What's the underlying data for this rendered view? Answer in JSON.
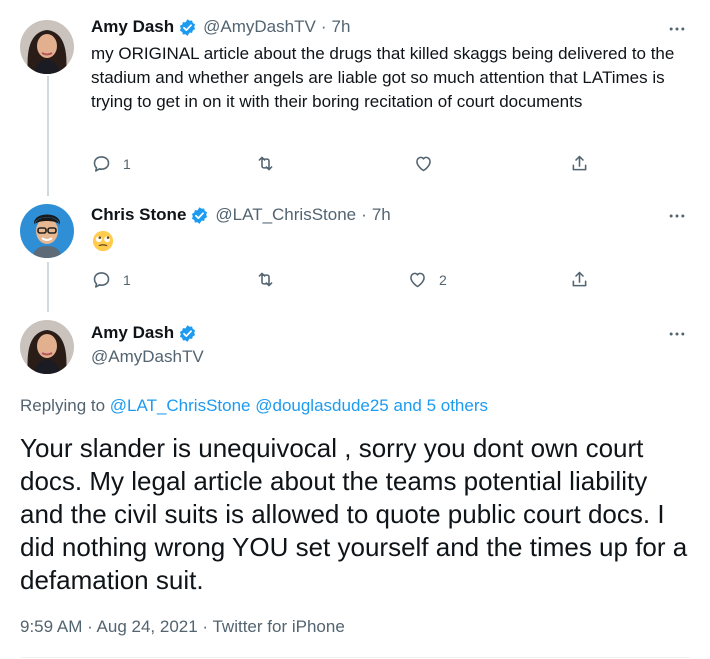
{
  "tweets": [
    {
      "name": "Amy Dash",
      "handle": "@AmyDashTV",
      "sep": "·",
      "time": "7h",
      "text": "my ORIGINAL article about the drugs that killed skaggs being delivered to the stadium and whether angels are liable got so much attention that LATimes is trying to get in on it with their boring recitation of court documents",
      "replies": "1",
      "retweets": "",
      "likes": ""
    },
    {
      "name": "Chris Stone",
      "handle": "@LAT_ChrisStone",
      "sep": "·",
      "time": "7h",
      "emoji": "face-with-rolling-eyes",
      "replies": "1",
      "retweets": "",
      "likes": "2"
    }
  ],
  "focused": {
    "name": "Amy Dash",
    "handle": "@AmyDashTV",
    "replying_prefix": "Replying to ",
    "replying_links": "@LAT_ChrisStone @douglasdude25 and 5 others",
    "text": "Your slander is unequivocal , sorry you dont own court docs. My legal article about the teams potential liability and the civil suits is allowed to quote public court docs. I did nothing wrong YOU set yourself and the times up for a defamation suit.",
    "meta": "9:59 AM · Aug 24, 2021 · Twitter for iPhone"
  },
  "icons": {
    "verified": "verified-badge-icon",
    "more": "more-dots-icon",
    "reply": "reply-icon",
    "retweet": "retweet-icon",
    "like": "heart-icon",
    "share": "share-icon"
  },
  "colors": {
    "accent": "#1d9bf0",
    "muted": "#536471",
    "text": "#0f1419",
    "thread_line": "#cfd9de"
  }
}
